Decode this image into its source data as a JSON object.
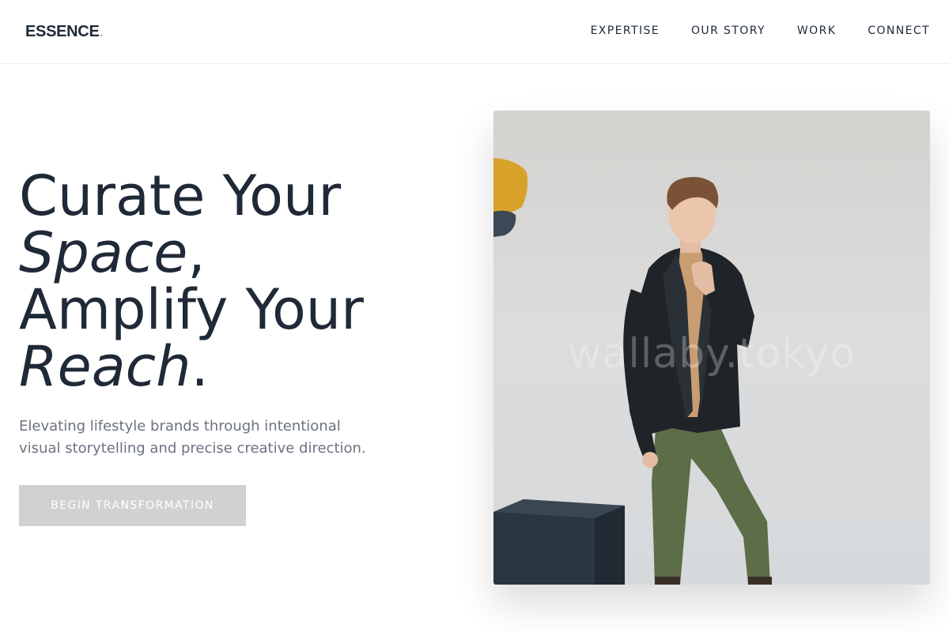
{
  "brand": {
    "name": "ESSENCE",
    "dot": "."
  },
  "nav": {
    "items": [
      {
        "label": "EXPERTISE"
      },
      {
        "label": "OUR STORY"
      },
      {
        "label": "WORK"
      },
      {
        "label": "CONNECT"
      }
    ]
  },
  "hero": {
    "title_line1": "Curate Your",
    "title_line2_em": "Space",
    "title_line2_rest": ",",
    "title_line3": "Amplify Your",
    "title_line4_em": "Reach",
    "title_line4_rest": ".",
    "subtitle": "Elevating lifestyle brands through intentional visual storytelling and precise creative direction.",
    "cta_label": "BEGIN TRANSFORMATION"
  },
  "photo": {
    "watermark": "wallaby.tokyo"
  },
  "colors": {
    "text": "#1f2937",
    "muted": "#6b7280",
    "button_bg": "#d1d1d1"
  }
}
